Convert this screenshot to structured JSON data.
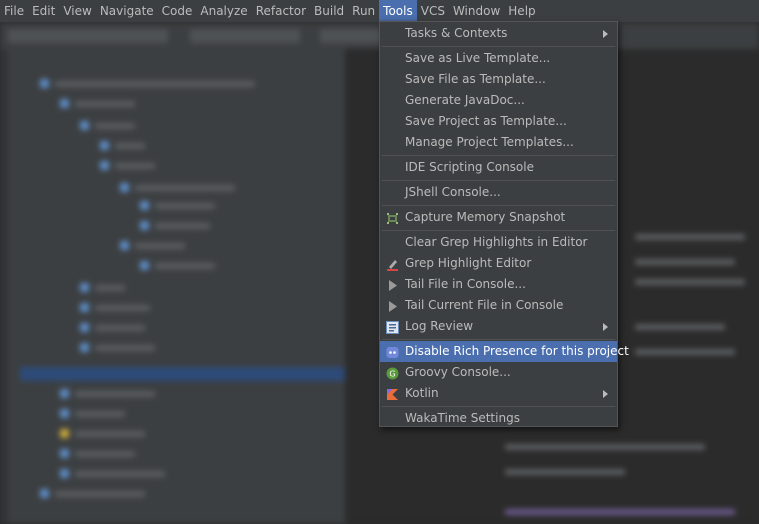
{
  "menubar": {
    "items": [
      "File",
      "Edit",
      "View",
      "Navigate",
      "Code",
      "Analyze",
      "Refactor",
      "Build",
      "Run",
      "Tools",
      "VCS",
      "Window",
      "Help"
    ],
    "active": "Tools"
  },
  "tools_menu": {
    "tasks_contexts": "Tasks & Contexts",
    "save_live_template": "Save as Live Template...",
    "save_file_template": "Save File as Template...",
    "generate_javadoc": "Generate JavaDoc...",
    "save_project_template": "Save Project as Template...",
    "manage_project_templates": "Manage Project Templates...",
    "ide_scripting_console": "IDE Scripting Console",
    "jshell_console": "JShell Console...",
    "capture_memory_snapshot": "Capture Memory Snapshot",
    "clear_grep_highlights": "Clear Grep Highlights in Editor",
    "grep_highlight_editor": "Grep Highlight Editor",
    "tail_file_console": "Tail File in Console...",
    "tail_current_file": "Tail Current File in Console",
    "log_review": "Log Review",
    "disable_rich_presence": "Disable Rich Presence for this project",
    "groovy_console": "Groovy Console...",
    "kotlin": "Kotlin",
    "wakatime_settings": "WakaTime Settings",
    "highlighted": "Disable Rich Presence for this project"
  },
  "icons": {
    "capture_memory": "memory-snapshot-icon",
    "grep_highlight": "pencil-highlight-icon",
    "tail_file": "play-triangle-icon",
    "tail_current": "play-triangle-icon",
    "log_review": "log-icon",
    "disable_rich_presence": "discord-icon",
    "groovy": "groovy-icon",
    "kotlin": "kotlin-icon"
  },
  "colors": {
    "menubar_bg": "#3c3f41",
    "menu_bg": "#3c3f41",
    "highlight": "#4b6eaf",
    "text": "#bbbbbb",
    "groovy_green": "#5a9a3c",
    "discord": "#7289da"
  }
}
